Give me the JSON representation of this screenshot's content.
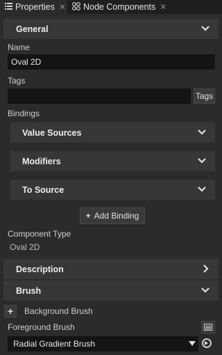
{
  "tabs": [
    {
      "label": "Properties",
      "icon": "list-icon",
      "active": true
    },
    {
      "label": "Node Components",
      "icon": "components-icon",
      "active": false
    }
  ],
  "general": {
    "title": "General",
    "name_label": "Name",
    "name_value": "Oval 2D",
    "tags_label": "Tags",
    "tags_value": "",
    "tags_button": "Tags",
    "bindings_label": "Bindings",
    "binding_sections": [
      "Value Sources",
      "Modifiers",
      "To Source"
    ],
    "add_binding": "Add Binding",
    "component_type_label": "Component Type",
    "component_type_value": "Oval 2D"
  },
  "description": {
    "title": "Description"
  },
  "brush": {
    "title": "Brush",
    "background_label": "Background Brush",
    "foreground_label": "Foreground Brush",
    "foreground_value": "Radial Gradient Brush"
  },
  "colors": {
    "accent": "#373737",
    "field": "#141414",
    "background": "#2b2b2b"
  }
}
